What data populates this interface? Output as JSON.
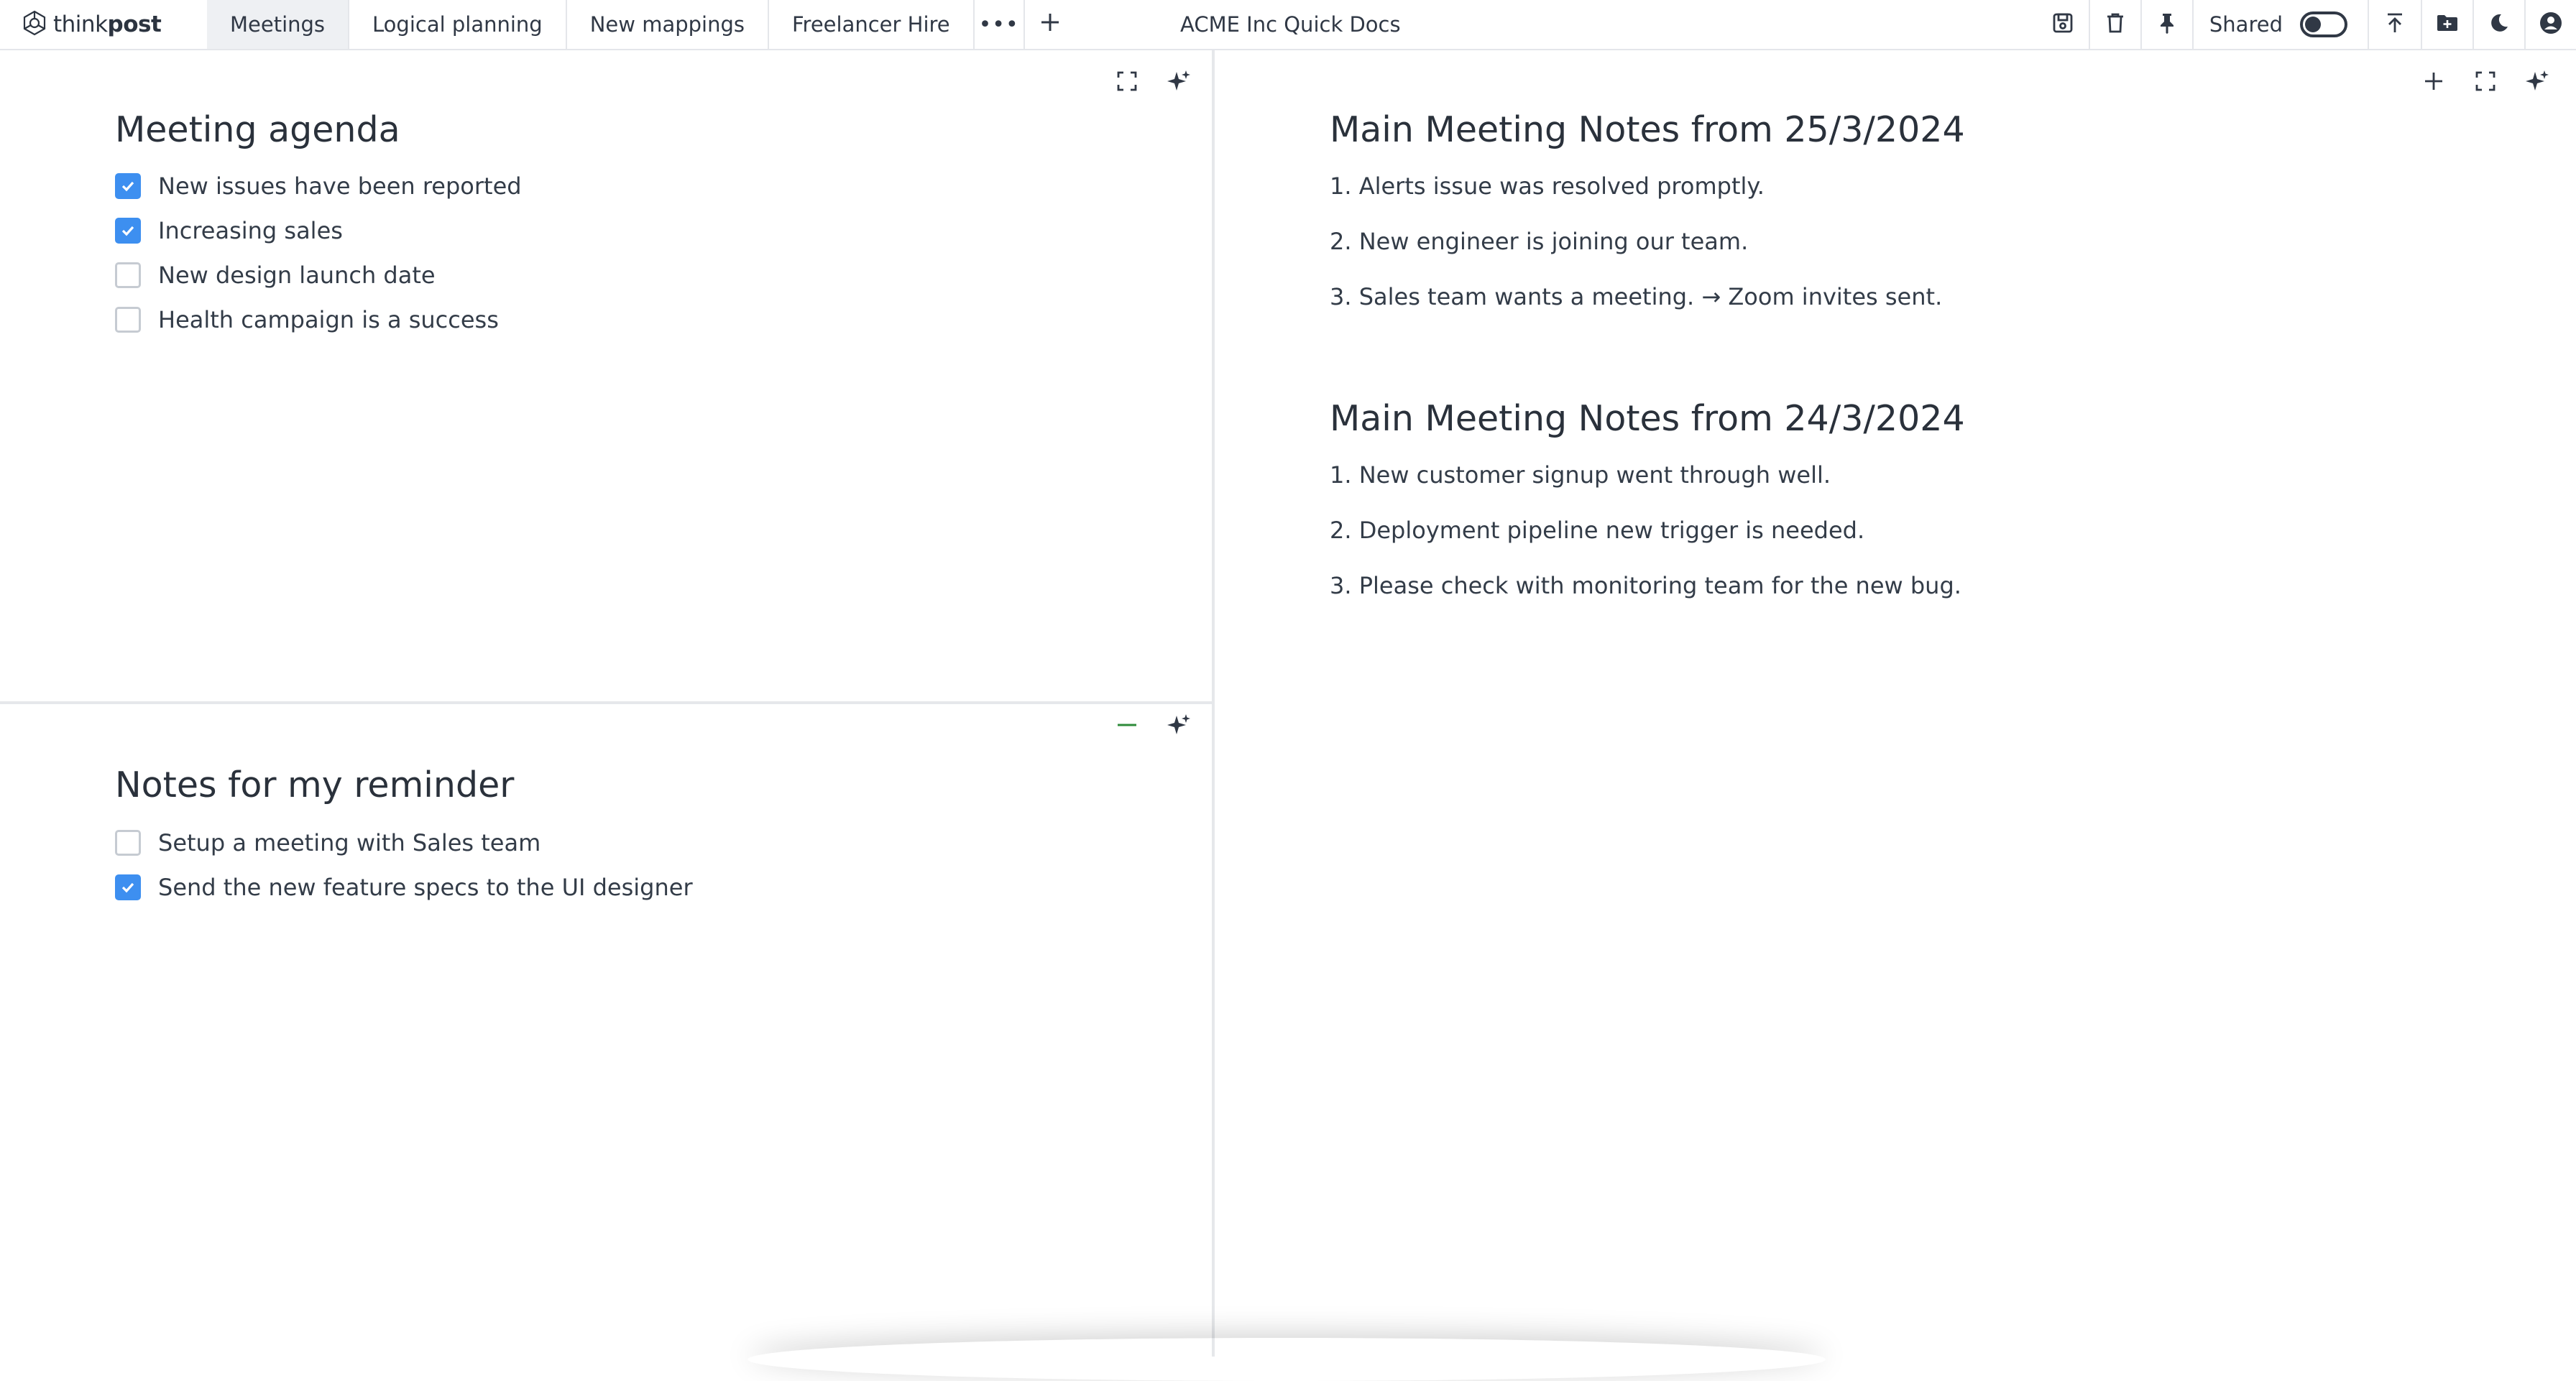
{
  "app": {
    "logo_light": "think",
    "logo_bold": "post",
    "doc_title": "ACME Inc Quick Docs"
  },
  "tabs": [
    {
      "label": "Meetings",
      "active": true
    },
    {
      "label": "Logical planning",
      "active": false
    },
    {
      "label": "New mappings",
      "active": false
    },
    {
      "label": "Freelancer Hire",
      "active": false
    }
  ],
  "tab_controls": {
    "more_icon": "ellipsis-icon",
    "more_label": "•••",
    "add_icon": "plus-icon"
  },
  "toolbar": {
    "icons": [
      "save-icon",
      "trash-icon",
      "pin-icon"
    ],
    "shared_label": "Shared",
    "shared_on": false,
    "right_icons": [
      "upload-icon",
      "folder-add-icon",
      "moon-icon",
      "account-icon"
    ]
  },
  "agenda": {
    "title": "Meeting agenda",
    "items": [
      {
        "text": "New issues have been reported",
        "checked": true
      },
      {
        "text": "Increasing sales",
        "checked": true
      },
      {
        "text": "New design launch date",
        "checked": false
      },
      {
        "text": "Health campaign is a success",
        "checked": false
      }
    ]
  },
  "reminder": {
    "title": "Notes for my reminder",
    "items": [
      {
        "text": "Setup a meeting with Sales team",
        "checked": false
      },
      {
        "text": "Send the new feature specs to the UI designer",
        "checked": true
      }
    ]
  },
  "notes": {
    "sections": [
      {
        "title": "Main Meeting Notes from 25/3/2024",
        "lines": [
          "1. Alerts issue was resolved promptly.",
          "2. New engineer is joining our team.",
          "3. Sales team wants a meeting. → Zoom invites sent."
        ]
      },
      {
        "title": "Main Meeting Notes from 24/3/2024",
        "lines": [
          "1. New customer signup went through well.",
          "2. Deployment pipeline new trigger is needed.",
          "3. Please check with monitoring team for the new bug."
        ]
      }
    ]
  },
  "colors": {
    "accent": "#3d8ff0",
    "minimize": "#2e8b3a",
    "text": "#2f3a46",
    "border": "#e4e6ea"
  }
}
